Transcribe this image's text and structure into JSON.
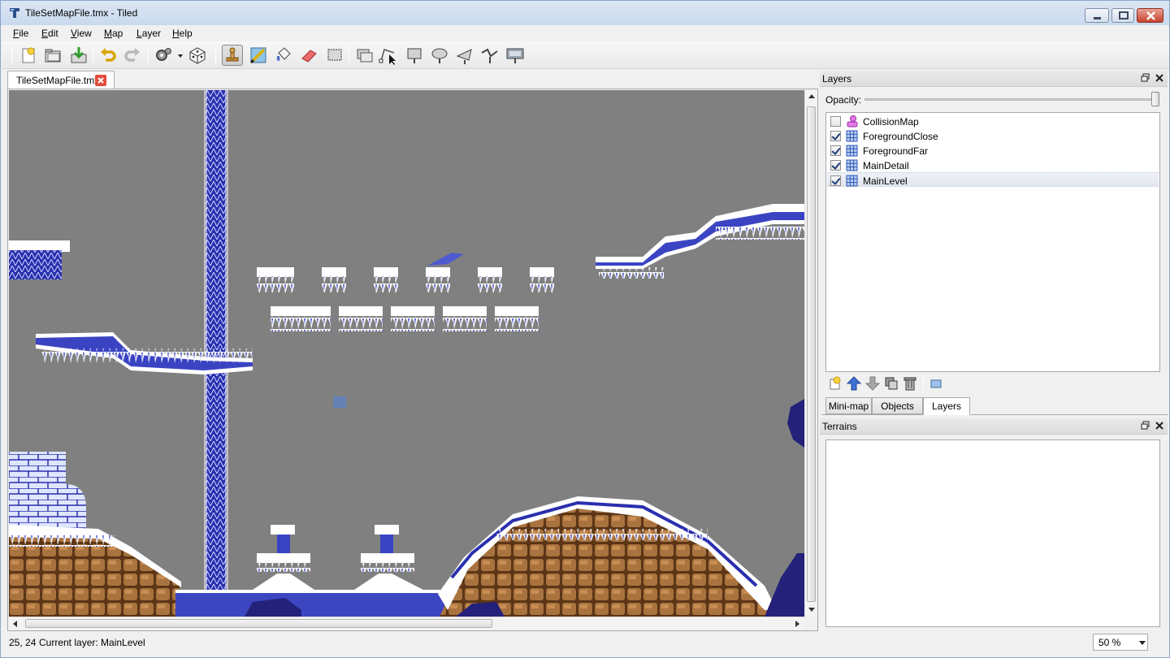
{
  "window": {
    "title": "TileSetMapFile.tmx - Tiled",
    "controls": [
      "minimize",
      "maximize",
      "close"
    ]
  },
  "menubar": {
    "items": [
      "File",
      "Edit",
      "View",
      "Map",
      "Layer",
      "Help"
    ]
  },
  "toolbar": {
    "buttons": [
      "new-icon",
      "open-icon",
      "save-icon",
      "undo-icon",
      "redo-icon",
      "commands-icon",
      "random-icon",
      "stamp-brush-icon",
      "terrain-brush-icon",
      "bucket-fill-icon",
      "eraser-icon",
      "rect-select-icon",
      "select-objects-icon",
      "edit-polygons-icon",
      "insert-rectangle-icon",
      "insert-ellipse-icon",
      "insert-polygon-icon",
      "insert-polyline-icon",
      "insert-tile-icon"
    ],
    "active_tool": "stamp-brush-icon"
  },
  "document": {
    "tab_label": "TileSetMapFile.tmx"
  },
  "layers_panel": {
    "title": "Layers",
    "opacity_label": "Opacity:",
    "opacity": 1.0,
    "layers": [
      {
        "name": "CollisionMap",
        "visible": false,
        "type": "object-layer-icon"
      },
      {
        "name": "ForegroundClose",
        "visible": true,
        "type": "tile-layer-icon"
      },
      {
        "name": "ForegroundFar",
        "visible": true,
        "type": "tile-layer-icon"
      },
      {
        "name": "MainDetail",
        "visible": true,
        "type": "tile-layer-icon"
      },
      {
        "name": "MainLevel",
        "visible": true,
        "type": "tile-layer-icon",
        "selected": true
      }
    ],
    "tools": [
      "add-layer-icon",
      "move-up-icon",
      "move-down-icon",
      "duplicate-layer-icon",
      "delete-layer-icon",
      "layer-properties-icon"
    ]
  },
  "panel_tabs": {
    "tabs": [
      "Mini-map",
      "Objects",
      "Layers"
    ],
    "active": "Layers"
  },
  "terrains_panel": {
    "title": "Terrains"
  },
  "statusbar": {
    "coords": "25, 24",
    "current_layer": "Current layer: MainLevel",
    "zoom": "50 %"
  },
  "colors": {
    "map_background": "#808080",
    "ice_blue": "#2a2fae",
    "snow_white": "#ffffff",
    "rock_brown": "#a0683a"
  }
}
